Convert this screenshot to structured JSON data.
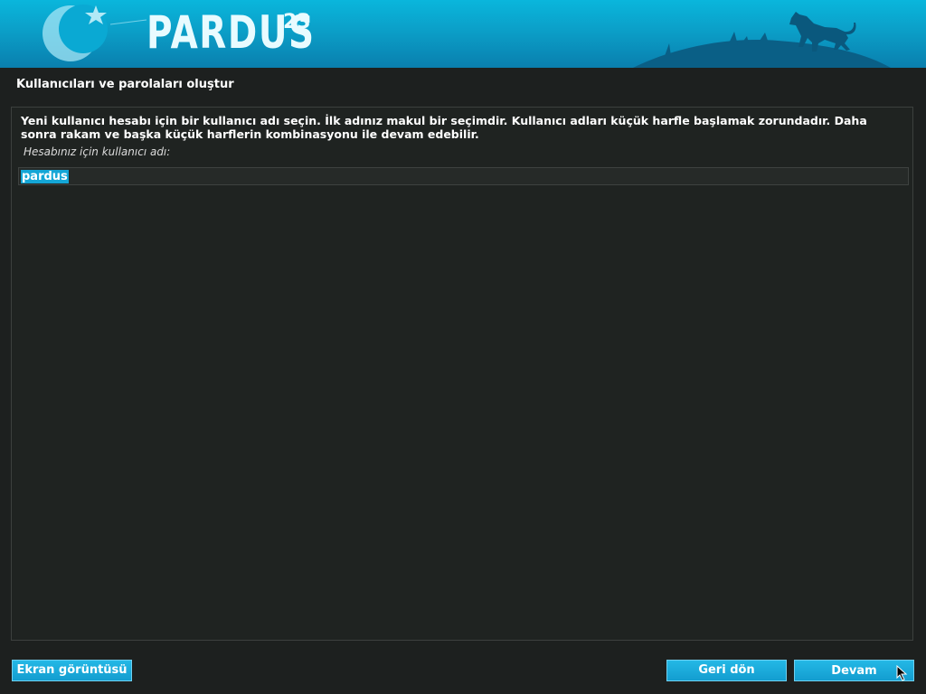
{
  "header": {
    "logo_text": "PARDUS",
    "logo_version": "23"
  },
  "step": {
    "title": "Kullanıcıları ve parolaları oluştur"
  },
  "main": {
    "description": "Yeni kullanıcı hesabı için bir kullanıcı adı seçin. İlk adınız makul bir seçimdir. Kullanıcı adları küçük harfle başlamak zorundadır. Daha sonra rakam ve başka küçük harflerin kombinasyonu ile devam edebilir.",
    "field_label": "Hesabınız için kullanıcı adı:",
    "username_value": "pardus"
  },
  "footer": {
    "screenshot_label": "Ekran görüntüsü",
    "back_label": "Geri dön",
    "continue_label": "Devam"
  },
  "colors": {
    "banner": "#0ab6dc",
    "background": "#1d201f",
    "accent": "#14a6d6"
  }
}
